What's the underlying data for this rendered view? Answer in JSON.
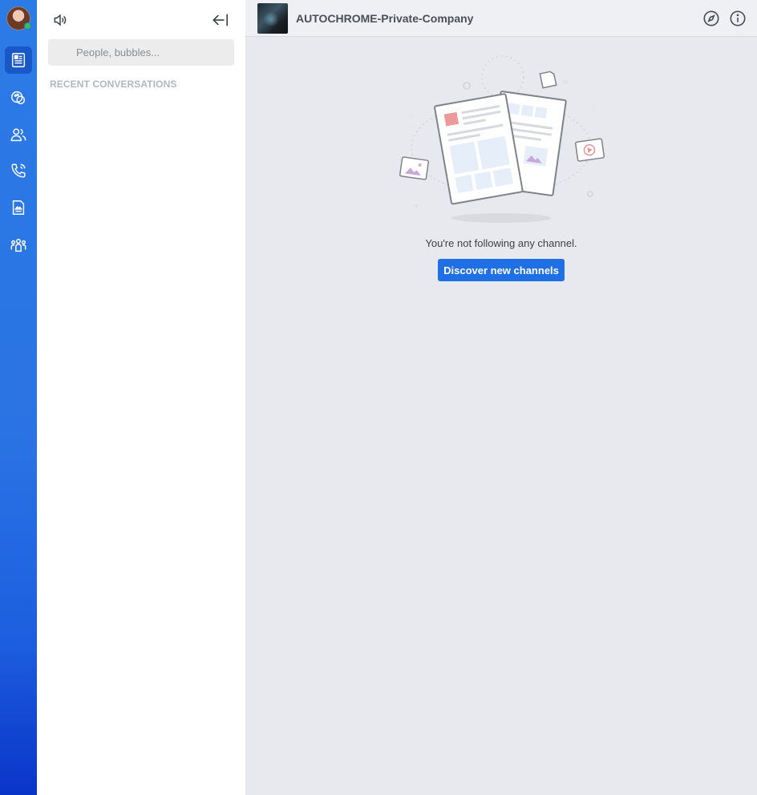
{
  "colors": {
    "rail_top": "#2b7be6",
    "rail_bottom": "#0a35c8",
    "accent": "#1f6fe5",
    "status_online": "#35c14a"
  },
  "rail": {
    "items": [
      {
        "name": "news-feed",
        "icon": "newspaper-icon",
        "active": true
      },
      {
        "name": "bubbles",
        "icon": "chat-bubbles-icon",
        "active": false
      },
      {
        "name": "contacts",
        "icon": "people-icon",
        "active": false
      },
      {
        "name": "calls",
        "icon": "phone-icon",
        "active": false
      },
      {
        "name": "files",
        "icon": "file-image-icon",
        "active": false
      },
      {
        "name": "teams",
        "icon": "group-icon",
        "active": false
      }
    ]
  },
  "panel": {
    "speaker_icon": "speaker-icon",
    "collapse_icon": "collapse-left-icon",
    "search": {
      "placeholder": "People, bubbles...",
      "value": ""
    },
    "recent_label": "RECENT CONVERSATIONS"
  },
  "header": {
    "company_name": "AUTOCHROME-Private-Company",
    "icons": [
      "compass-icon",
      "info-icon"
    ]
  },
  "empty_state": {
    "message": "You're not following any channel.",
    "button_label": "Discover new channels"
  }
}
